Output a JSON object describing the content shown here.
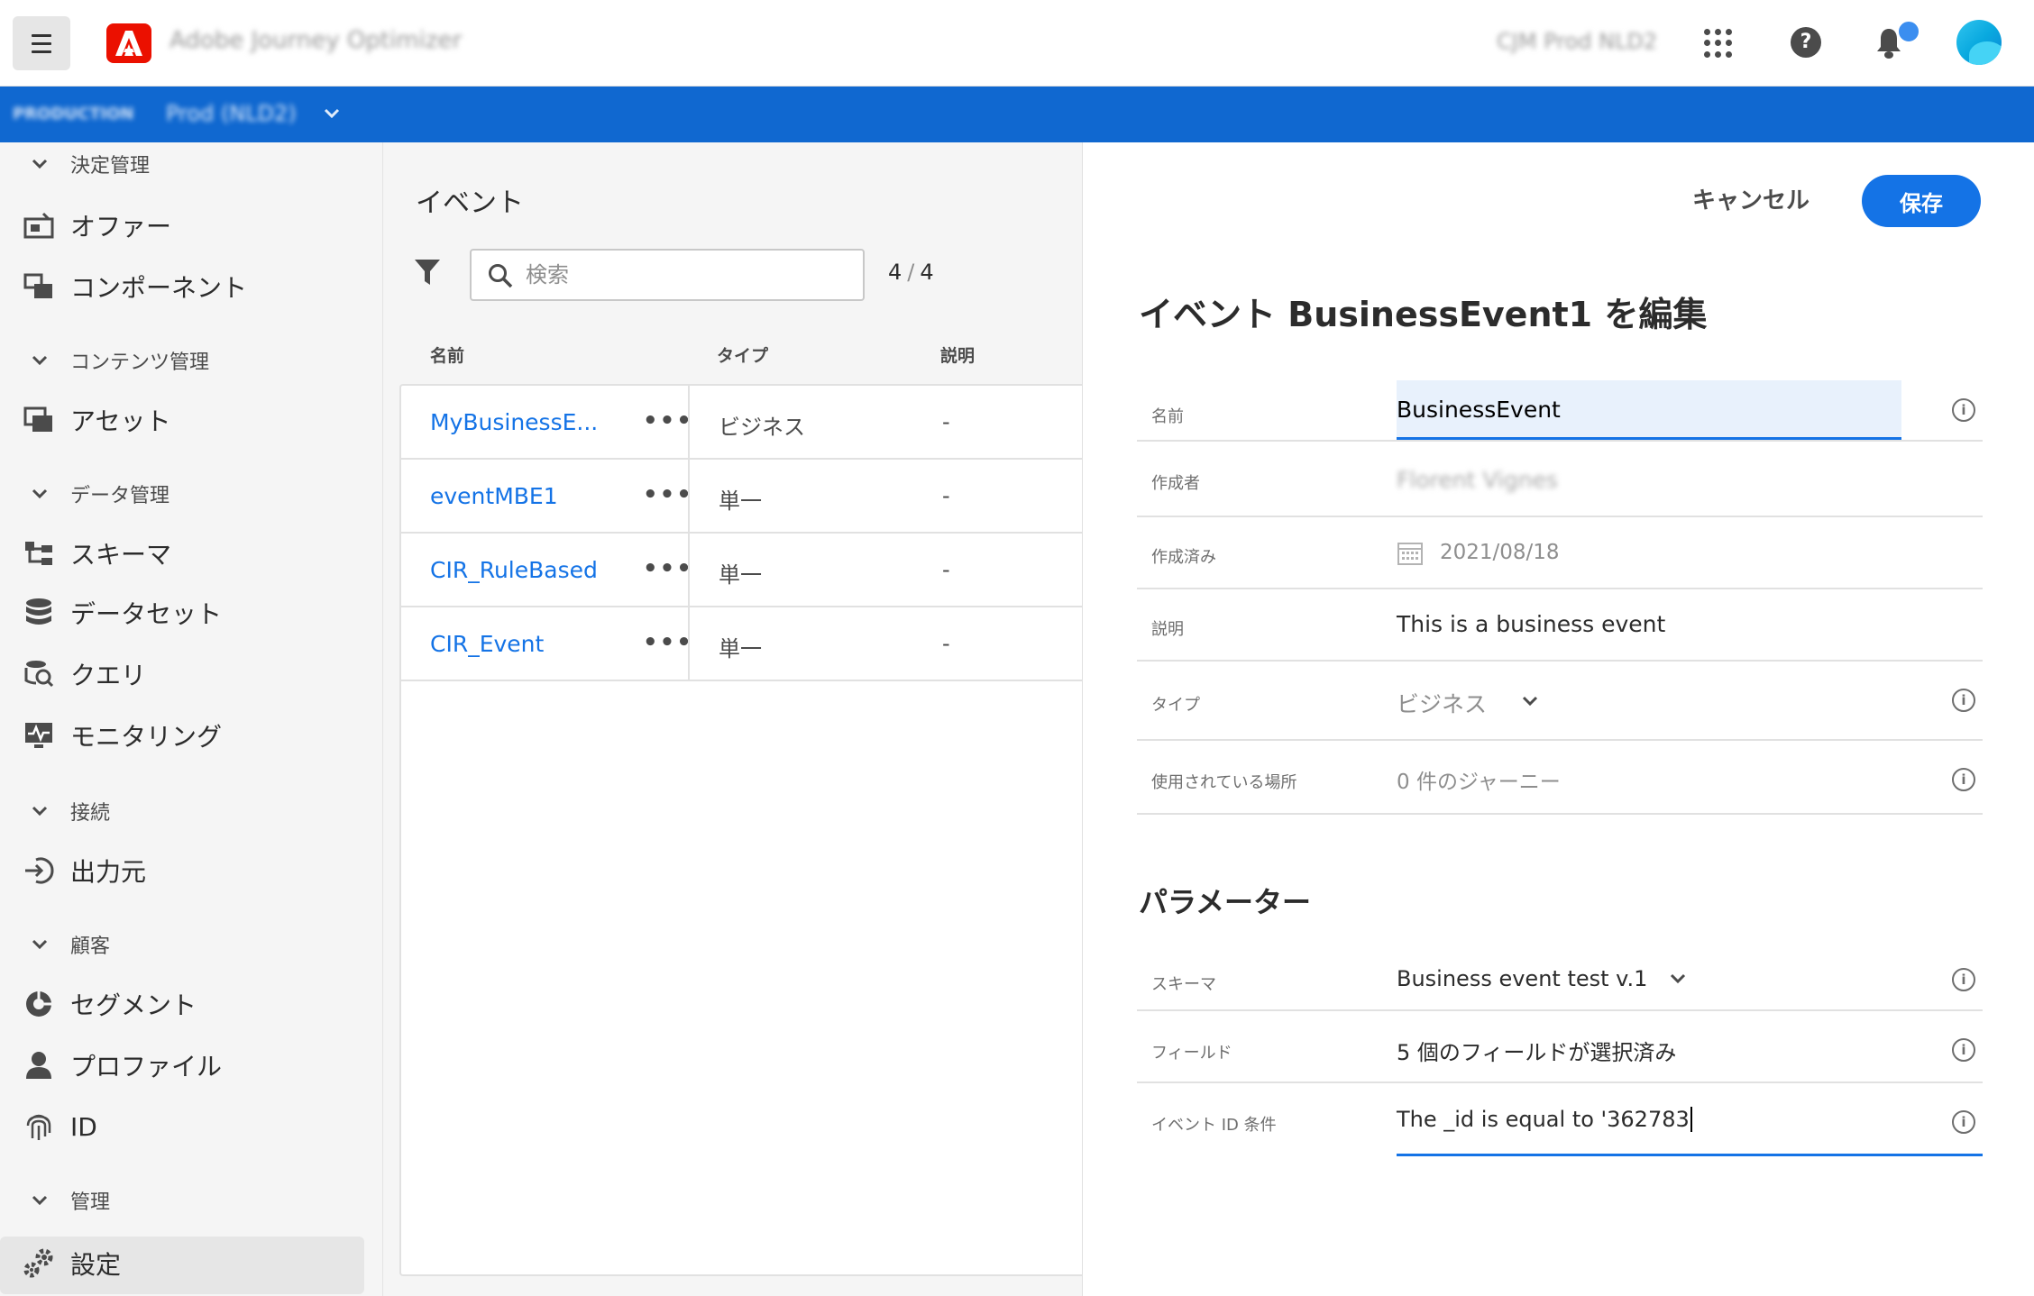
{
  "header": {
    "app_title": "Adobe Journey Optimizer",
    "org_name": "CJM Prod NLD2"
  },
  "sandbox": {
    "label": "PRODUCTION",
    "name": "Prod (NLD2)"
  },
  "nav": {
    "sections": {
      "decision": "決定管理",
      "content": "コンテンツ管理",
      "data": "データ管理",
      "connections": "接続",
      "customers": "顧客",
      "admin": "管理"
    },
    "items": {
      "offers": "オファー",
      "components": "コンポーネント",
      "assets": "アセット",
      "schemas": "スキーマ",
      "datasets": "データセット",
      "queries": "クエリ",
      "monitoring": "モニタリング",
      "sources": "出力元",
      "segments": "セグメント",
      "profiles": "プロファイル",
      "identities": "ID",
      "settings": "設定"
    }
  },
  "events_list": {
    "title": "イベント",
    "search_placeholder": "検索",
    "count_current": "4",
    "count_total": "4",
    "columns": {
      "name": "名前",
      "type": "タイプ",
      "description": "説明"
    },
    "rows": [
      {
        "name": "MyBusinessE...",
        "more": "•••",
        "type": "ビジネス",
        "description": "-"
      },
      {
        "name": "eventMBE1",
        "more": "•••",
        "type": "単一",
        "description": "-"
      },
      {
        "name": "CIR_RuleBased",
        "more": "•••",
        "type": "単一",
        "description": "-"
      },
      {
        "name": "CIR_Event",
        "more": "•••",
        "type": "単一",
        "description": "-"
      }
    ]
  },
  "editor": {
    "cancel_label": "キャンセル",
    "save_label": "保存",
    "title": "イベント BusinessEvent1 を編集",
    "fields": {
      "name_label": "名前",
      "name_value": "BusinessEvent",
      "author_label": "作成者",
      "author_value": "Florent Vignes",
      "created_label": "作成済み",
      "created_value": "2021/08/18",
      "description_label": "説明",
      "description_value": "This is a business event",
      "type_label": "タイプ",
      "type_value": "ビジネス",
      "usage_label": "使用されている場所",
      "usage_value": "0 件のジャーニー"
    },
    "parameters": {
      "title": "パラメーター",
      "schema_label": "スキーマ",
      "schema_value": "Business event test v.1",
      "fields_label": "フィールド",
      "fields_value": "5 個のフィールドが選択済み",
      "event_id_label": "イベント ID 条件",
      "event_id_value": "The _id is equal to '362783"
    },
    "info_glyph": "i"
  },
  "colors": {
    "accent": "#1473e6",
    "sandbox_bar": "#1068d0",
    "adobe_red": "#eb1000"
  }
}
